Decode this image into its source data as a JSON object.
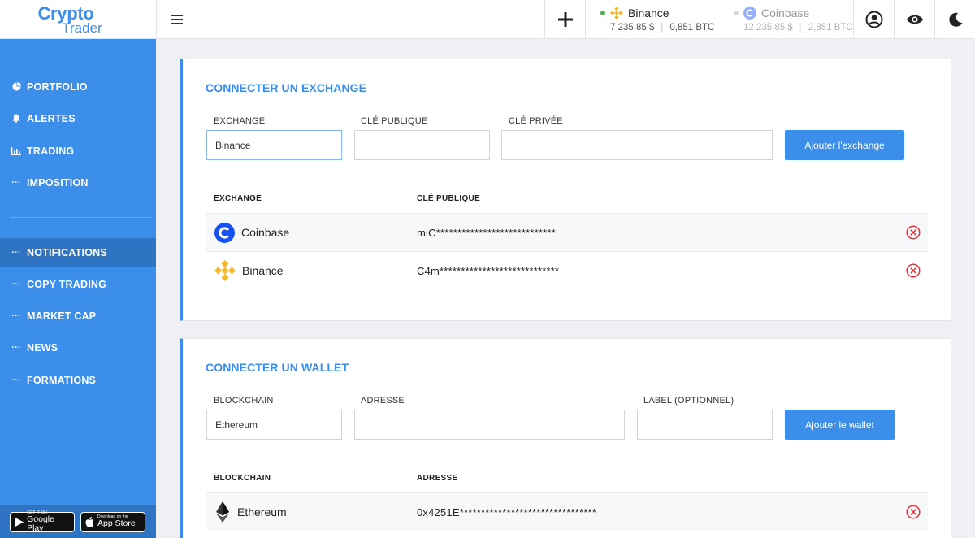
{
  "brand": {
    "line1": "Crypto",
    "line2": "Trader"
  },
  "topbar": {
    "exchanges": [
      {
        "name": "Binance",
        "usd": "7 235,85 $",
        "btc": "0,851 BTC"
      },
      {
        "name": "Coinbase",
        "usd": "12 235,85 $",
        "btc": "2,851 BTC"
      }
    ]
  },
  "sidebar": {
    "items": [
      {
        "label": "PORTFOLIO",
        "icon": "pie-chart-icon"
      },
      {
        "label": "ALERTES",
        "icon": "bell-icon"
      },
      {
        "label": "TRADING",
        "icon": "bar-chart-icon"
      },
      {
        "label": "IMPOSITION",
        "icon": "dots-icon"
      },
      {
        "label": "NOTIFICATIONS",
        "icon": "dots-icon",
        "active": true
      },
      {
        "label": "COPY TRADING",
        "icon": "dots-icon"
      },
      {
        "label": "MARKET CAP",
        "icon": "dots-icon"
      },
      {
        "label": "NEWS",
        "icon": "dots-icon"
      },
      {
        "label": "FORMATIONS",
        "icon": "dots-icon"
      }
    ],
    "stores": {
      "google": {
        "small": "GET IT ON",
        "big": "Google Play"
      },
      "apple": {
        "small": "Download on the",
        "big": "App Store"
      }
    }
  },
  "exchange_panel": {
    "title": "CONNECTER UN EXCHANGE",
    "labels": {
      "exchange": "EXCHANGE",
      "public_key": "CLÉ PUBLIQUE",
      "private_key": "CLÉ PRIVÉE"
    },
    "values": {
      "exchange": "Binance",
      "public_key": "",
      "private_key": ""
    },
    "button": "Ajouter l'exchange",
    "table": {
      "headers": [
        "EXCHANGE",
        "CLÉ PUBLIQUE"
      ],
      "rows": [
        {
          "name": "Coinbase",
          "key": "miC****************************"
        },
        {
          "name": "Binance",
          "key": "C4m****************************"
        }
      ]
    }
  },
  "wallet_panel": {
    "title": "CONNECTER UN WALLET",
    "labels": {
      "blockchain": "BLOCKCHAIN",
      "address": "ADRESSE",
      "label": "LABEL (OPTIONNEL)"
    },
    "values": {
      "blockchain": "Ethereum",
      "address": "",
      "label": ""
    },
    "button": "Ajouter le wallet",
    "table": {
      "headers": [
        "BLOCKCHAIN",
        "ADRESSE"
      ],
      "rows": [
        {
          "name": "Ethereum",
          "key": "0x4251E********************************"
        }
      ]
    }
  },
  "colors": {
    "accent": "#3b8ee9",
    "sidebar_active": "#2e74c2",
    "delete": "#e0343a",
    "binance": "#f3ba2f",
    "coinbase": "#1652f0"
  }
}
